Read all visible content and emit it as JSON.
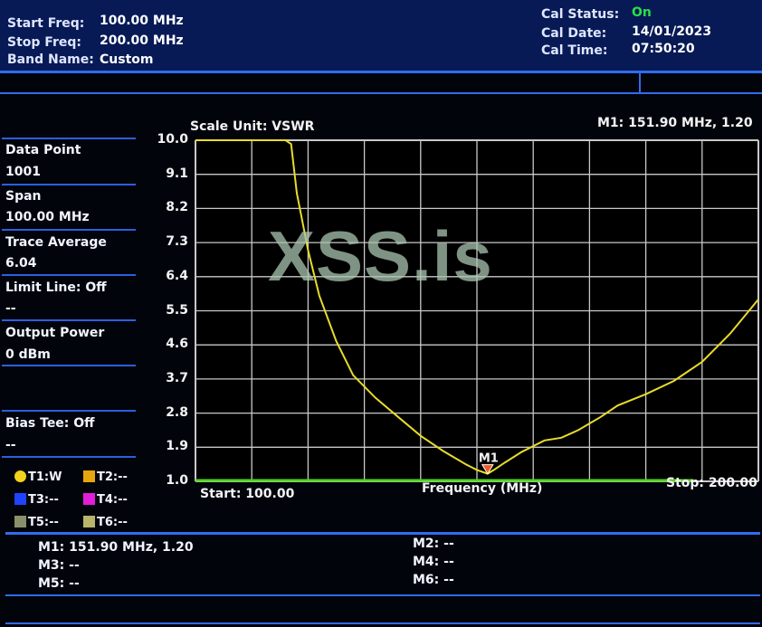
{
  "header": {
    "start_freq_label": "Start Freq:",
    "start_freq_value": "100.00 MHz",
    "stop_freq_label": "Stop Freq:",
    "stop_freq_value": "200.00 MHz",
    "band_name_label": "Band Name:",
    "band_name_value": "Custom",
    "cal_status_label": "Cal Status:",
    "cal_status_value": "On",
    "cal_date_label": "Cal Date:",
    "cal_date_value": "14/01/2023",
    "cal_time_label": "Cal Time:",
    "cal_time_value": "07:50:20"
  },
  "sidebar": {
    "items": [
      {
        "label": "Data Point"
      },
      {
        "label": "1001"
      },
      {
        "label": "Span"
      },
      {
        "label": "100.00 MHz"
      },
      {
        "label": "Trace Average"
      },
      {
        "label": "6.04"
      },
      {
        "label": "Limit Line: Off"
      },
      {
        "label": "--"
      },
      {
        "label": "Output Power"
      },
      {
        "label": "0 dBm"
      },
      {
        "label": "Bias Tee: Off"
      },
      {
        "label": "--"
      }
    ]
  },
  "traces": [
    {
      "label": "T1:W",
      "color": "#f2d21a",
      "icon": "circle-icon"
    },
    {
      "label": "T2:--",
      "color": "#e5a60e",
      "icon": "square-icon"
    },
    {
      "label": "T3:--",
      "color": "#1f44ff",
      "icon": "square-icon"
    },
    {
      "label": "T4:--",
      "color": "#e21fd8",
      "icon": "square-icon"
    },
    {
      "label": "T5:--",
      "color": "#8a8f6a",
      "icon": "square-icon"
    },
    {
      "label": "T6:--",
      "color": "#b8b46a",
      "icon": "square-icon"
    }
  ],
  "plot": {
    "scale_unit": "Scale Unit: VSWR",
    "marker_readout": "M1: 151.90 MHz, 1.20",
    "start_label": "Start: 100.00",
    "stop_label": "Stop: 200.00",
    "xlabel": "Frequency (MHz)",
    "marker_name": "M1",
    "watermark": "XSS.is",
    "trace_color": "#e8dc2a",
    "limit_color": "#4fd61e"
  },
  "chart_data": {
    "type": "line",
    "ylabel": "VSWR",
    "xlabel": "Frequency (MHz)",
    "xlim": [
      100,
      200
    ],
    "ylim": [
      1.0,
      10.0
    ],
    "yticks": [
      "10.0",
      "9.1",
      "8.2",
      "7.3",
      "6.4",
      "5.5",
      "4.6",
      "3.7",
      "2.8",
      "1.9",
      "1.0"
    ],
    "grid": true,
    "series": [
      {
        "x": [
          100,
          116,
          117,
          118,
          120,
          122,
          125,
          128,
          132,
          136,
          140,
          144,
          148,
          150,
          151.9,
          153,
          155,
          158,
          162,
          165,
          168,
          172,
          175,
          180,
          185,
          190,
          195,
          200
        ],
        "values": [
          10.0,
          10.0,
          9.9,
          8.6,
          7.1,
          5.9,
          4.7,
          3.8,
          3.2,
          2.7,
          2.2,
          1.8,
          1.45,
          1.3,
          1.2,
          1.3,
          1.5,
          1.78,
          2.08,
          2.15,
          2.35,
          2.7,
          3.0,
          3.3,
          3.65,
          4.15,
          4.9,
          5.8
        ]
      }
    ],
    "markers": [
      {
        "name": "M1",
        "x": 151.9,
        "y": 1.2
      }
    ]
  },
  "markers_panel": {
    "m1": "M1: 151.90 MHz, 1.20",
    "m2": "M2: --",
    "m3": "M3: --",
    "m4": "M4: --",
    "m5": "M5: --",
    "m6": "M6: --"
  }
}
